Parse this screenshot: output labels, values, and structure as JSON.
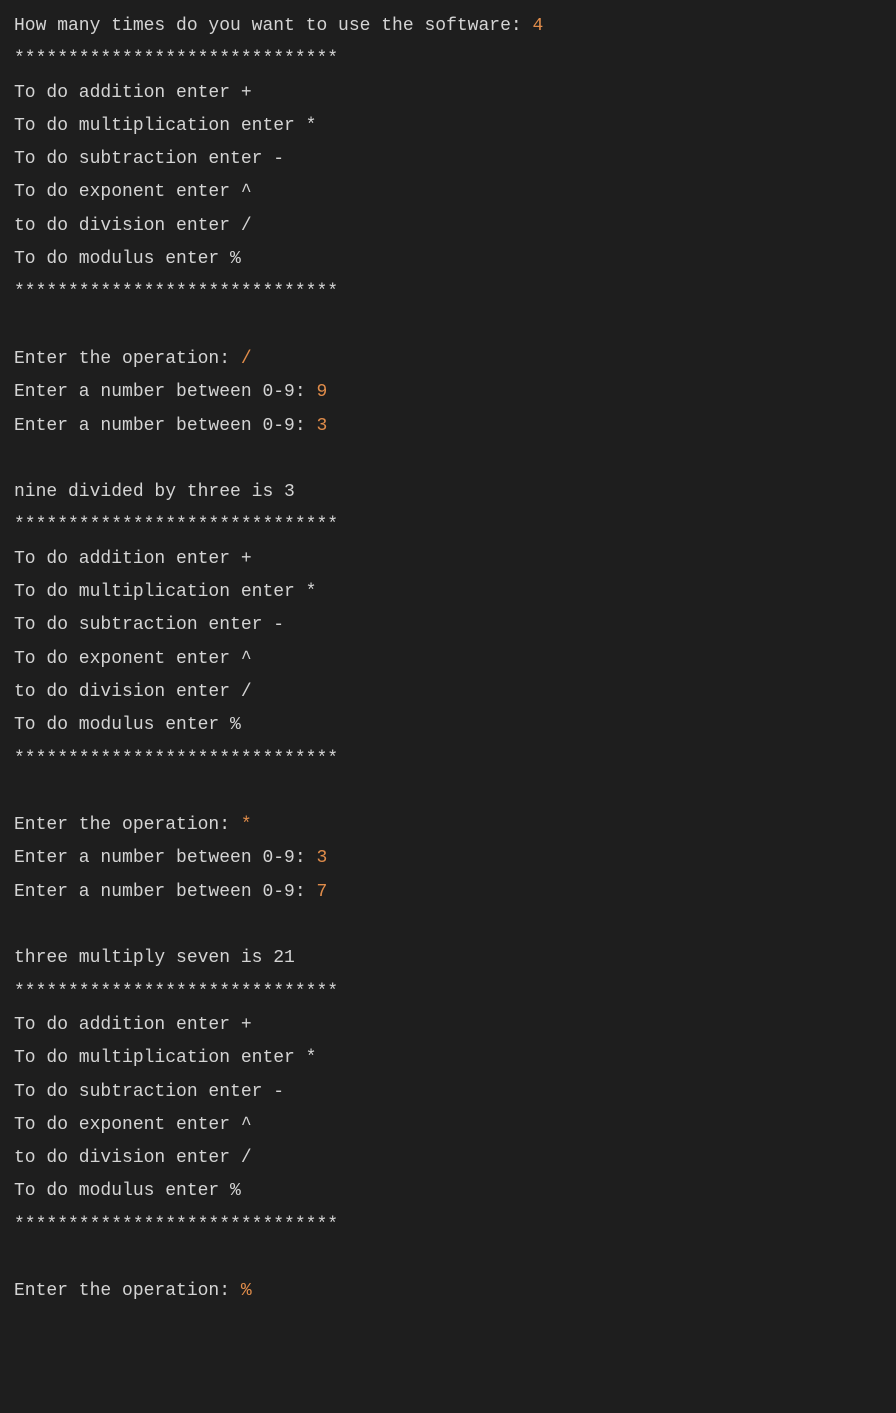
{
  "terminal": {
    "lines": [
      {
        "type": "mixed",
        "parts": [
          {
            "text": "How many times do you want to use the software: ",
            "style": "normal"
          },
          {
            "text": "4",
            "style": "input"
          }
        ]
      },
      {
        "type": "normal",
        "text": "******************************"
      },
      {
        "type": "normal",
        "text": "To do addition enter +"
      },
      {
        "type": "normal",
        "text": "To do multiplication enter *"
      },
      {
        "type": "normal",
        "text": "To do subtraction enter -"
      },
      {
        "type": "normal",
        "text": "To do exponent enter ^"
      },
      {
        "type": "normal",
        "text": "to do division enter /"
      },
      {
        "type": "normal",
        "text": "To do modulus enter %"
      },
      {
        "type": "normal",
        "text": "******************************"
      },
      {
        "type": "blank"
      },
      {
        "type": "mixed",
        "parts": [
          {
            "text": "Enter the operation: ",
            "style": "normal"
          },
          {
            "text": "/",
            "style": "input"
          }
        ]
      },
      {
        "type": "mixed",
        "parts": [
          {
            "text": "Enter a number between 0-9: ",
            "style": "normal"
          },
          {
            "text": "9",
            "style": "input"
          }
        ]
      },
      {
        "type": "mixed",
        "parts": [
          {
            "text": "Enter a number between 0-9: ",
            "style": "normal"
          },
          {
            "text": "3",
            "style": "input"
          }
        ]
      },
      {
        "type": "blank"
      },
      {
        "type": "normal",
        "text": "nine divided by three is 3"
      },
      {
        "type": "normal",
        "text": "******************************"
      },
      {
        "type": "normal",
        "text": "To do addition enter +"
      },
      {
        "type": "normal",
        "text": "To do multiplication enter *"
      },
      {
        "type": "normal",
        "text": "To do subtraction enter -"
      },
      {
        "type": "normal",
        "text": "To do exponent enter ^"
      },
      {
        "type": "normal",
        "text": "to do division enter /"
      },
      {
        "type": "normal",
        "text": "To do modulus enter %"
      },
      {
        "type": "normal",
        "text": "******************************"
      },
      {
        "type": "blank"
      },
      {
        "type": "mixed",
        "parts": [
          {
            "text": "Enter the operation: ",
            "style": "normal"
          },
          {
            "text": "*",
            "style": "input"
          }
        ]
      },
      {
        "type": "mixed",
        "parts": [
          {
            "text": "Enter a number between 0-9: ",
            "style": "normal"
          },
          {
            "text": "3",
            "style": "input"
          }
        ]
      },
      {
        "type": "mixed",
        "parts": [
          {
            "text": "Enter a number between 0-9: ",
            "style": "normal"
          },
          {
            "text": "7",
            "style": "input"
          }
        ]
      },
      {
        "type": "blank"
      },
      {
        "type": "normal",
        "text": "three multiply seven is 21"
      },
      {
        "type": "normal",
        "text": "******************************"
      },
      {
        "type": "normal",
        "text": "To do addition enter +"
      },
      {
        "type": "normal",
        "text": "To do multiplication enter *"
      },
      {
        "type": "normal",
        "text": "To do subtraction enter -"
      },
      {
        "type": "normal",
        "text": "To do exponent enter ^"
      },
      {
        "type": "normal",
        "text": "to do division enter /"
      },
      {
        "type": "normal",
        "text": "To do modulus enter %"
      },
      {
        "type": "normal",
        "text": "******************************"
      },
      {
        "type": "blank"
      },
      {
        "type": "mixed",
        "parts": [
          {
            "text": "Enter the operation: ",
            "style": "normal"
          },
          {
            "text": "%",
            "style": "input"
          }
        ]
      }
    ]
  }
}
